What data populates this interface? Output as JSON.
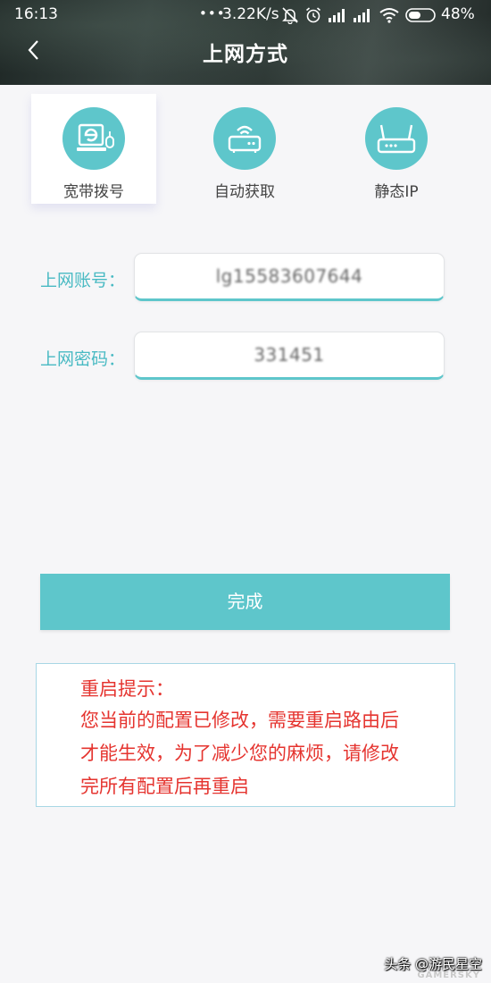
{
  "status_bar": {
    "time": "16:13",
    "dots": "•••",
    "speed": "3.22K/s",
    "battery": "48%",
    "icons": [
      "mute-bell-icon",
      "alarm-icon",
      "signal-icon",
      "signal-icon",
      "wifi-icon",
      "battery-icon"
    ]
  },
  "header": {
    "title": "上网方式",
    "back_icon": "chevron-left-icon"
  },
  "tabs": [
    {
      "label": "宽带拨号",
      "icon": "pppoe-dial-icon",
      "selected": true
    },
    {
      "label": "自动获取",
      "icon": "router-wifi-icon",
      "selected": false
    },
    {
      "label": "静态IP",
      "icon": "router-antenna-icon",
      "selected": false
    }
  ],
  "form": {
    "account_label": "上网账号：",
    "account_value": "lg15583607644",
    "password_label": "上网密码：",
    "password_value": "331451"
  },
  "submit_label": "完成",
  "notice": {
    "title": "重启提示：",
    "lines": [
      "您当前的配置已修改，需要重启路由后",
      "才能生效，为了减少您的麻烦，请修改",
      "完所有配置后再重启"
    ]
  },
  "watermark": {
    "text": "头条 @游民星空",
    "brand": "GAMERSKY"
  },
  "colors": {
    "accent": "#5ec6cb",
    "label": "#49bac3",
    "warning": "#e5342f",
    "notice_border": "#a8d7e5",
    "background": "#f6f6f8"
  }
}
